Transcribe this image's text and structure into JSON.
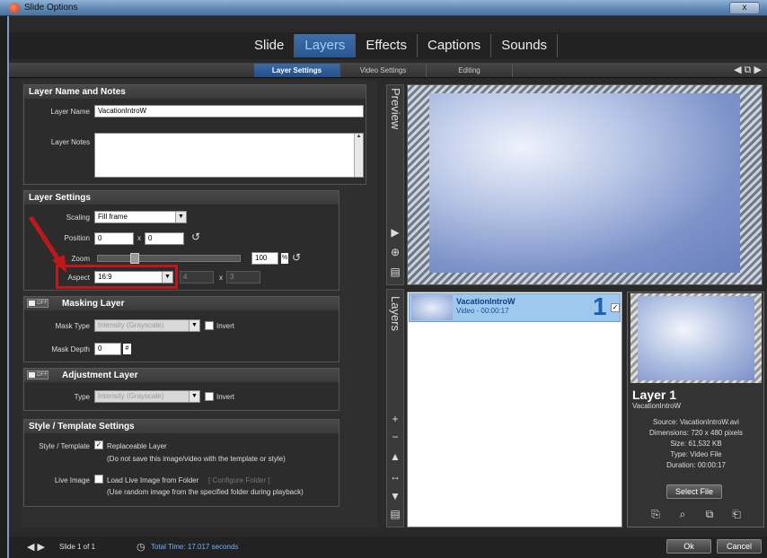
{
  "window": {
    "title": "Slide Options",
    "close": "x"
  },
  "main_tabs": [
    "Slide",
    "Layers",
    "Effects",
    "Captions",
    "Sounds"
  ],
  "sub_tabs": [
    "Layer Settings",
    "Video Settings",
    "Editing"
  ],
  "layer_name_notes": {
    "title": "Layer Name and Notes",
    "name_label": "Layer Name",
    "name_value": "VacationIntroW",
    "notes_label": "Layer Notes"
  },
  "layer_settings": {
    "title": "Layer Settings",
    "scaling_label": "Scaling",
    "scaling_value": "Fill frame",
    "position_label": "Position",
    "pos_x": "0",
    "pos_y": "0",
    "pos_sep": "x",
    "zoom_label": "Zoom",
    "zoom_value": "100",
    "zoom_unit": "%",
    "aspect_label": "Aspect",
    "aspect_value": "16:9",
    "aspect_w": "4",
    "aspect_h": "3",
    "aspect_sep": "x"
  },
  "masking": {
    "title": "Masking Layer",
    "off": "OFF",
    "type_label": "Mask Type",
    "type_value": "Intensity (Grayscale)",
    "invert": "Invert",
    "depth_label": "Mask Depth",
    "depth_value": "0",
    "depth_suffix": "#"
  },
  "adjustment": {
    "title": "Adjustment Layer",
    "off": "OFF",
    "type_label": "Type",
    "type_value": "Intensity (Grayscale)",
    "invert": "Invert"
  },
  "style_template": {
    "title": "Style / Template Settings",
    "st_label": "Style / Template",
    "replaceable": "Replaceable Layer",
    "replaceable_note": "(Do not save this image/video with the template or style)",
    "live_label": "Live Image",
    "live_text": "Load Live Image from Folder",
    "configure": "[ Configure Folder ]",
    "live_note": "(Use random image from the specified folder during playback)"
  },
  "preview": {
    "label": "Preview"
  },
  "layers_panel": {
    "label": "Layers",
    "item_name": "VacationIntroW",
    "item_sub": "Video - 00:00:17",
    "item_number": "1"
  },
  "layer_info": {
    "title": "Layer 1",
    "name": "VacationIntroW",
    "source": "Source: VacationIntroW.avi",
    "dimensions": "Dimensions: 720 x 480 pixels",
    "size": "Size: 61,532 KB",
    "type": "Type: Video File",
    "duration": "Duration: 00:00:17",
    "select_file": "Select File"
  },
  "footer": {
    "slide": "Slide 1 of 1",
    "total_time": "Total Time: 17.017 seconds",
    "ok": "Ok",
    "cancel": "Cancel"
  },
  "colors": {
    "accent": "#2a5690",
    "highlight": "#c0171b"
  }
}
